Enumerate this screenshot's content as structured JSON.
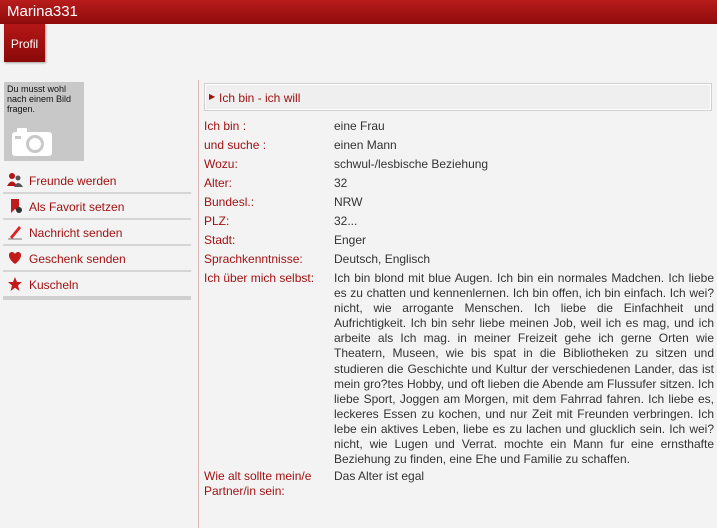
{
  "header": {
    "username": "Marina331"
  },
  "tabs": {
    "profile_label": "Profil"
  },
  "photo": {
    "notice": "Du musst wohl nach einem Bild fragen."
  },
  "actions": [
    {
      "label": "Freunde werden",
      "icon": "friends-icon"
    },
    {
      "label": "Als Favorit setzen",
      "icon": "bookmark-icon"
    },
    {
      "label": "Nachricht senden",
      "icon": "pencil-icon"
    },
    {
      "label": "Geschenk senden",
      "icon": "gift-icon"
    },
    {
      "label": "Kuscheln",
      "icon": "star-icon"
    }
  ],
  "section": {
    "title": "Ich bin - ich will",
    "arrow_icon": "triangle-right-icon"
  },
  "profile": {
    "rows": [
      {
        "label": "Ich bin :",
        "value": "eine Frau"
      },
      {
        "label": "und suche :",
        "value": "einen Mann"
      },
      {
        "label": "Wozu:",
        "value": "schwul-/lesbische Beziehung"
      },
      {
        "label": "Alter:",
        "value": "32"
      },
      {
        "label": "Bundesl.:",
        "value": "NRW"
      },
      {
        "label": "PLZ:",
        "value": "32..."
      },
      {
        "label": "Stadt:",
        "value": "Enger"
      },
      {
        "label": "Sprachkenntnisse:",
        "value": "Deutsch, Englisch"
      }
    ],
    "about_label": "Ich über mich selbst:",
    "about_text": "Ich bin blond mit blue Augen. Ich bin ein normales Madchen. Ich liebe es zu chatten und kennenlernen. Ich bin offen, ich bin einfach. Ich wei? nicht, wie arrogante Menschen. Ich liebe die Einfachheit und Aufrichtigkeit. Ich bin sehr liebe meinen Job, weil ich es mag, und ich arbeite als Ich mag. in meiner Freizeit gehe ich gerne Orten wie Theatern, Museen, wie bis spat in die Bibliotheken zu sitzen und studieren die Geschichte und Kultur der verschiedenen Lander, das ist mein gro?tes Hobby, und oft lieben die Abende am Flussufer sitzen. Ich liebe Sport, Joggen am Morgen, mit dem Fahrrad fahren. Ich liebe es, leckeres Essen zu kochen, und nur Zeit mit Freunden verbringen. Ich lebe ein aktives Leben, liebe es zu lachen und glucklich sein. Ich wei? nicht, wie Lugen und Verrat. mochte ein Mann fur eine ernsthafte Beziehung zu finden, eine Ehe und Familie zu schaffen.",
    "age_pref_label": "Wie alt sollte mein/e Partner/in sein:",
    "age_pref_value": "Das Alter ist egal"
  },
  "colors": {
    "brand_red": "#a01212",
    "header_red": "#b91c1c"
  }
}
